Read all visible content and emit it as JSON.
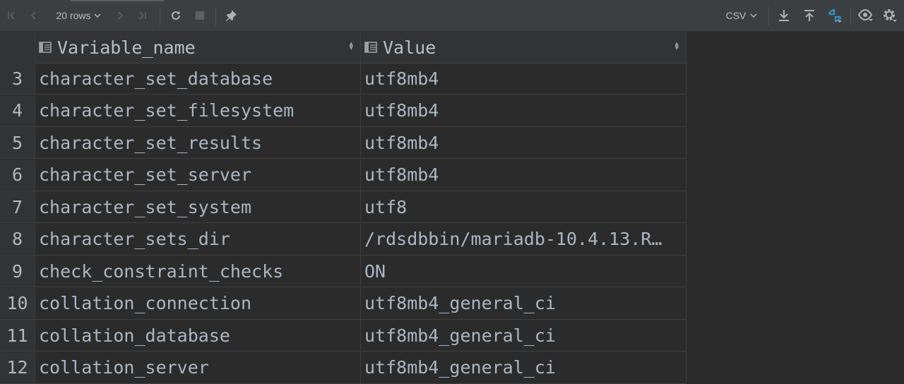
{
  "toolbar": {
    "rows_label": "20 rows",
    "format_label": "CSV"
  },
  "grid": {
    "columns": [
      {
        "label": "Variable_name"
      },
      {
        "label": "Value"
      }
    ],
    "rows": [
      {
        "num": "3",
        "name": "character_set_database",
        "value": "utf8mb4"
      },
      {
        "num": "4",
        "name": "character_set_filesystem",
        "value": "utf8mb4"
      },
      {
        "num": "5",
        "name": "character_set_results",
        "value": "utf8mb4"
      },
      {
        "num": "6",
        "name": "character_set_server",
        "value": "utf8mb4"
      },
      {
        "num": "7",
        "name": "character_set_system",
        "value": "utf8"
      },
      {
        "num": "8",
        "name": "character_sets_dir",
        "value": "/rdsdbbin/mariadb-10.4.13.R…"
      },
      {
        "num": "9",
        "name": "check_constraint_checks",
        "value": "ON"
      },
      {
        "num": "10",
        "name": "collation_connection",
        "value": "utf8mb4_general_ci"
      },
      {
        "num": "11",
        "name": "collation_database",
        "value": "utf8mb4_general_ci"
      },
      {
        "num": "12",
        "name": "collation_server",
        "value": "utf8mb4_general_ci"
      }
    ]
  },
  "icons": {
    "first_page": "first-page-icon",
    "prev_page": "prev-page-icon",
    "next_page": "next-page-icon",
    "last_page": "last-page-icon",
    "reload": "reload-icon",
    "stop": "stop-icon",
    "pin": "pin-icon",
    "download": "download-icon",
    "upload": "upload-icon",
    "compare": "compare-icon",
    "view": "eye-icon",
    "settings": "gear-icon"
  },
  "colors": {
    "background": "#2b2b2b",
    "toolbar": "#3c3f41",
    "text": "#a9b7c6",
    "accent": "#3592c4"
  }
}
